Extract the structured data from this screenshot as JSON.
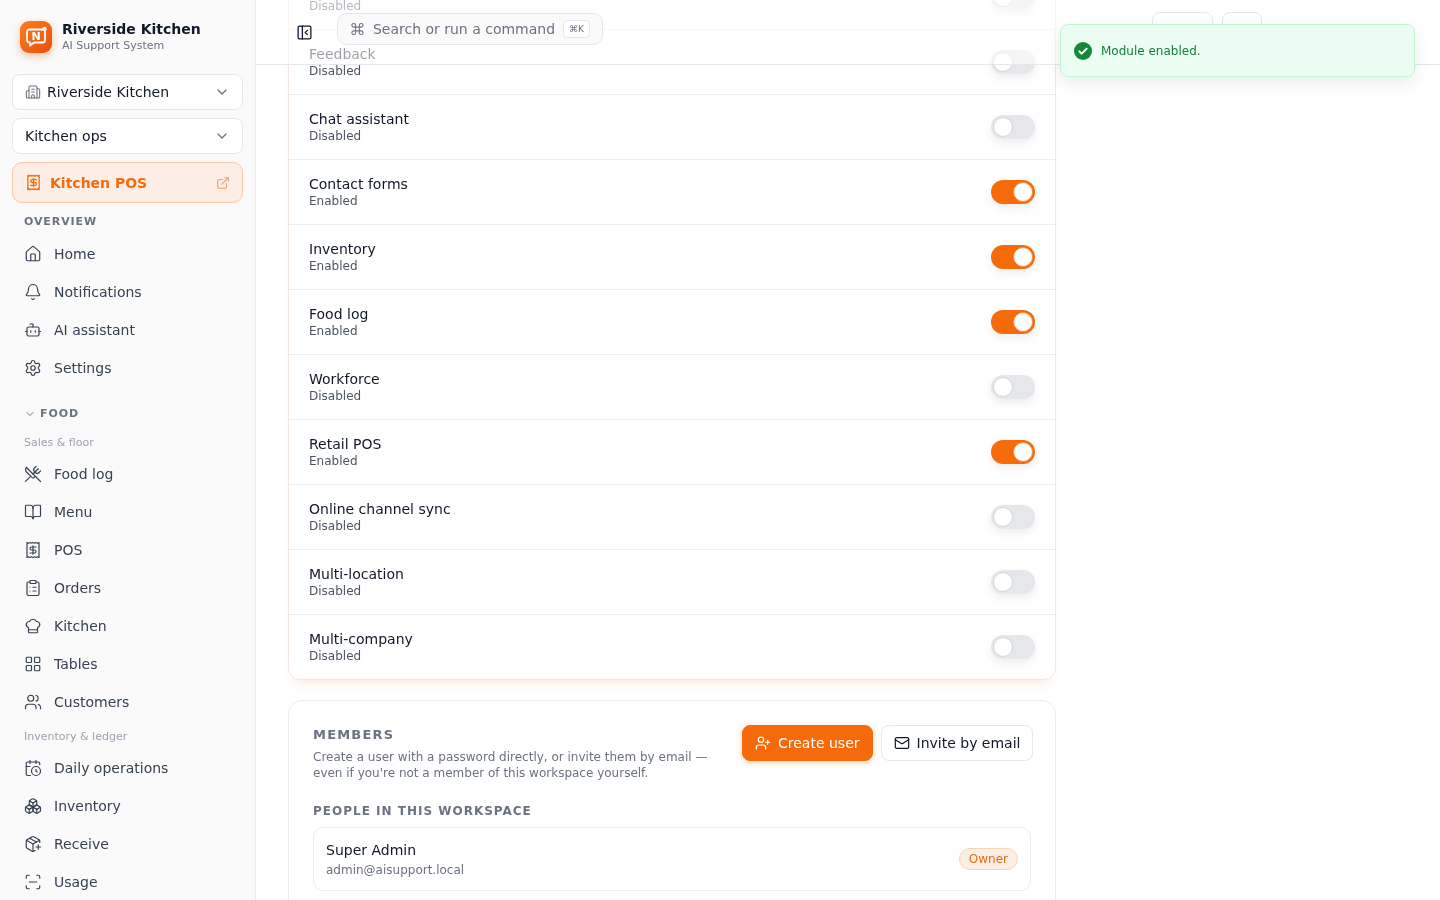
{
  "sidebar": {
    "brand": {
      "logo_letter": "N",
      "title": "Riverside Kitchen",
      "subtitle": "AI Support System"
    },
    "selectors": [
      {
        "kind": "location",
        "label": "Riverside Kitchen"
      },
      {
        "kind": "plain",
        "label": "Kitchen ops"
      }
    ],
    "module": {
      "label": "Kitchen POS"
    },
    "sections": [
      {
        "kind": "static",
        "title": "OVERVIEW",
        "groups": [
          {
            "items": [
              "Home",
              "Notifications",
              "AI assistant",
              "Settings"
            ]
          }
        ]
      },
      {
        "kind": "collapsible",
        "title": "FOOD",
        "expanded": true,
        "groups": [
          {
            "label": "Sales & floor",
            "items": [
              "Food log",
              "Menu",
              "POS",
              "Orders",
              "Kitchen",
              "Tables",
              "Customers"
            ]
          },
          {
            "label": "Inventory & ledger",
            "items": [
              "Daily operations",
              "Inventory",
              "Receive",
              "Usage"
            ]
          }
        ]
      }
    ]
  },
  "header": {
    "search": {
      "label": "Search or run a command",
      "shortcut": "⌘K"
    },
    "buttons": [
      {
        "kind": "wide"
      },
      {
        "kind": "narrow"
      }
    ]
  },
  "modules": [
    {
      "status": "Disabled",
      "on": false
    },
    {
      "name": "Feedback",
      "status": "Disabled",
      "on": false
    },
    {
      "name": "Chat assistant",
      "status": "Disabled",
      "on": false
    },
    {
      "name": "Contact forms",
      "status": "Enabled",
      "on": true
    },
    {
      "name": "Inventory",
      "status": "Enabled",
      "on": true
    },
    {
      "name": "Food log",
      "status": "Enabled",
      "on": true
    },
    {
      "name": "Workforce",
      "status": "Disabled",
      "on": false
    },
    {
      "name": "Retail POS",
      "status": "Enabled",
      "on": true
    },
    {
      "name": "Online channel sync",
      "status": "Disabled",
      "on": false
    },
    {
      "name": "Multi-location",
      "status": "Disabled",
      "on": false
    },
    {
      "name": "Multi-company",
      "status": "Disabled",
      "on": false
    }
  ],
  "members": {
    "title": "MEMBERS",
    "description": "Create a user with a password directly, or invite them by email — even if you're not a member of this workspace yourself.",
    "actions": [
      {
        "kind": "primary",
        "label": "Create user"
      },
      {
        "kind": "secondary",
        "label": "Invite by email"
      }
    ],
    "people_title": "PEOPLE IN THIS WORKSPACE",
    "people": [
      {
        "name": "Super Admin",
        "email": "admin@aisupport.local",
        "role": "Owner"
      }
    ]
  },
  "toast": {
    "kind": "success",
    "message": "Module enabled."
  }
}
